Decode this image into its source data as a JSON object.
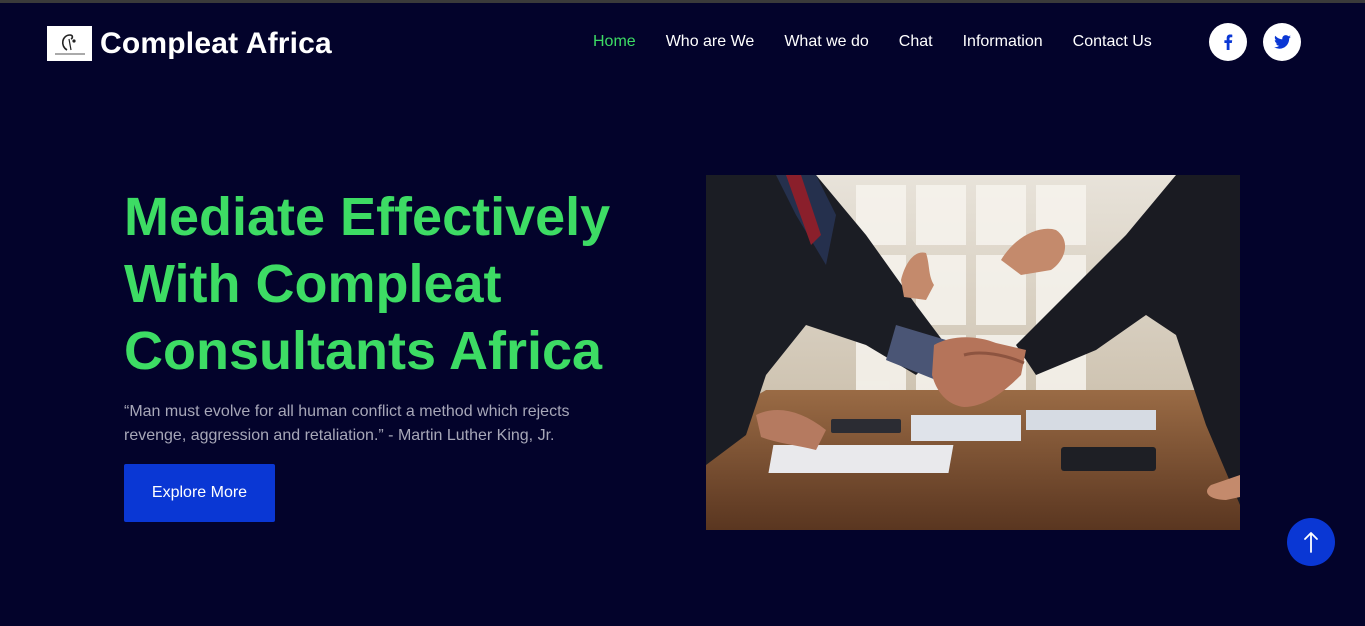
{
  "header": {
    "brand": "Compleat Africa",
    "logo_icon": "handshake-pen-logo-icon",
    "nav": [
      {
        "label": "Home",
        "active": true
      },
      {
        "label": "Who are We",
        "active": false
      },
      {
        "label": "What we do",
        "active": false
      },
      {
        "label": "Chat",
        "active": false
      },
      {
        "label": "Information",
        "active": false
      },
      {
        "label": "Contact Us",
        "active": false
      }
    ],
    "social": [
      {
        "icon": "facebook-icon"
      },
      {
        "icon": "twitter-icon"
      }
    ]
  },
  "hero": {
    "title_lines": [
      "Mediate Effectively",
      "With Compleat",
      "Consultants Africa"
    ],
    "quote": "“Man must evolve for all human conflict a method which rejects revenge, aggression and retaliation.” - Martin Luther King, Jr.",
    "cta_label": "Explore More",
    "image_icon": "handshake-meeting-photo"
  },
  "back_to_top_icon": "arrow-up-icon",
  "colors": {
    "background": "#03032b",
    "accent_green": "#3ddc64",
    "button_blue": "#0a37d4",
    "quote_gray": "#a7a7b8"
  }
}
